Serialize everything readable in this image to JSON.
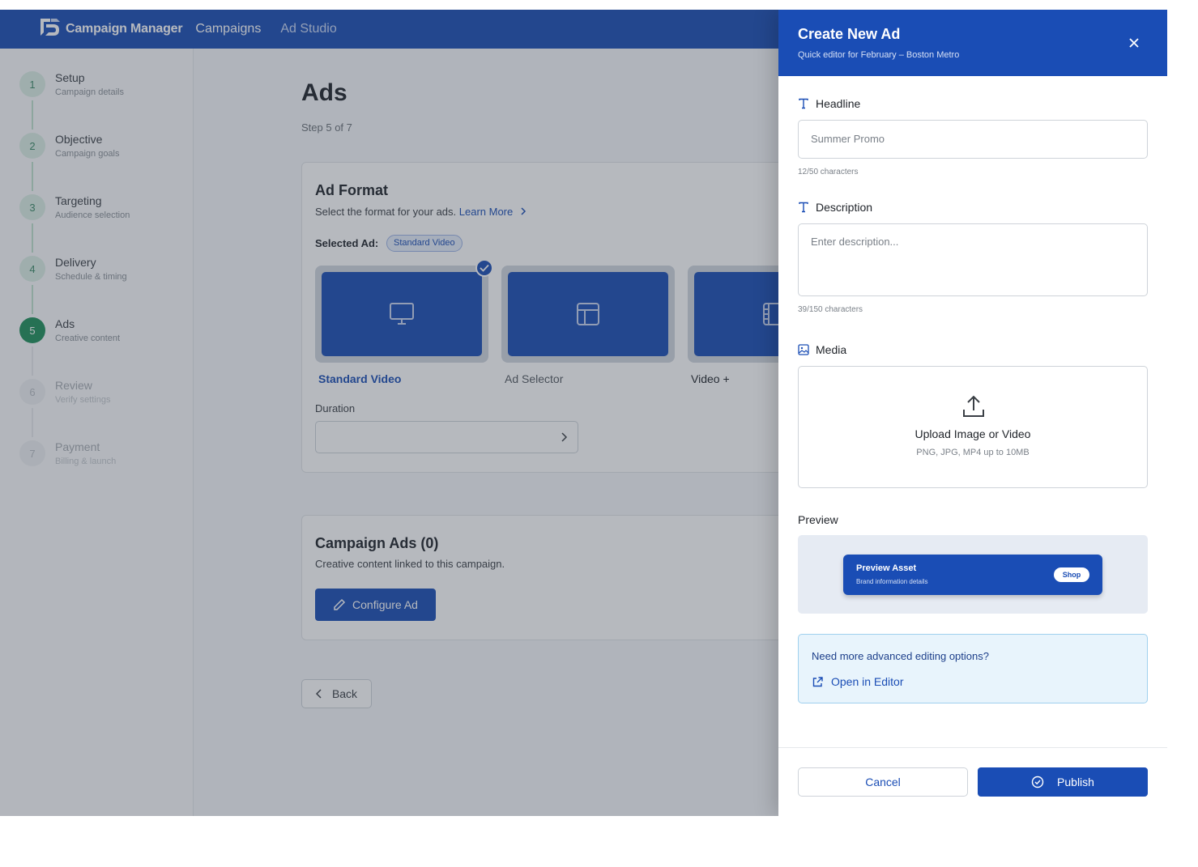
{
  "topbar": {
    "logo_text": "Campaign Manager",
    "nav": [
      "Campaigns",
      "Ad Studio"
    ]
  },
  "sidebar": {
    "steps": [
      {
        "num": "1",
        "title": "Setup",
        "sub": "Campaign details",
        "state": "done"
      },
      {
        "num": "2",
        "title": "Objective",
        "sub": "Campaign goals",
        "state": "done"
      },
      {
        "num": "3",
        "title": "Targeting",
        "sub": "Audience selection",
        "state": "done"
      },
      {
        "num": "4",
        "title": "Delivery",
        "sub": "Schedule & timing",
        "state": "done"
      },
      {
        "num": "5",
        "title": "Ads",
        "sub": "Creative content",
        "state": "active"
      },
      {
        "num": "6",
        "title": "Review",
        "sub": "Verify settings",
        "state": "future"
      },
      {
        "num": "7",
        "title": "Payment",
        "sub": "Billing & launch",
        "state": "future"
      }
    ]
  },
  "main": {
    "title": "Ads",
    "step_text": "Step 5 of 7",
    "ad_format": {
      "title": "Ad Format",
      "subtitle": "Select the format for your ads.",
      "learn_more": "Learn More",
      "selected_label": "Selected Ad:",
      "selected_value": "Standard Video",
      "tiles": [
        {
          "label": "Standard Video",
          "icon": "monitor-icon",
          "selected": true
        },
        {
          "label": "Ad Selector",
          "icon": "layout-icon",
          "selected": false
        },
        {
          "label": "Video +",
          "icon": "film-icon",
          "selected": false
        }
      ],
      "duration_label": "Duration",
      "duration_value": ""
    },
    "campaign_ads": {
      "title": "Campaign Ads (0)",
      "subtitle": "Creative content linked to this campaign.",
      "configure_label": "Configure Ad"
    },
    "back_label": "Back"
  },
  "drawer": {
    "title": "Create New Ad",
    "subtitle": "Quick editor for February – Boston Metro",
    "headline_label": "Headline",
    "headline_value": "Summer Promo",
    "headline_counter": "12/50 characters",
    "description_label": "Description",
    "description_placeholder": "Enter description...",
    "description_counter": "39/150 characters",
    "media_label": "Media",
    "upload_title": "Upload Image or Video",
    "upload_sub": "PNG, JPG, MP4 up to 10MB",
    "preview_label": "Preview",
    "preview": {
      "title": "Preview Asset",
      "sub": "Brand information details",
      "button": "Shop"
    },
    "info_question": "Need more advanced editing options?",
    "info_link": "Open in Editor",
    "cancel_label": "Cancel",
    "publish_label": "Publish"
  },
  "colors": {
    "brand": "#1a4db5",
    "step_active": "#1f8f5a",
    "overlay": "rgba(52,62,75,0.36)",
    "info_bg": "#e8f4fc"
  }
}
